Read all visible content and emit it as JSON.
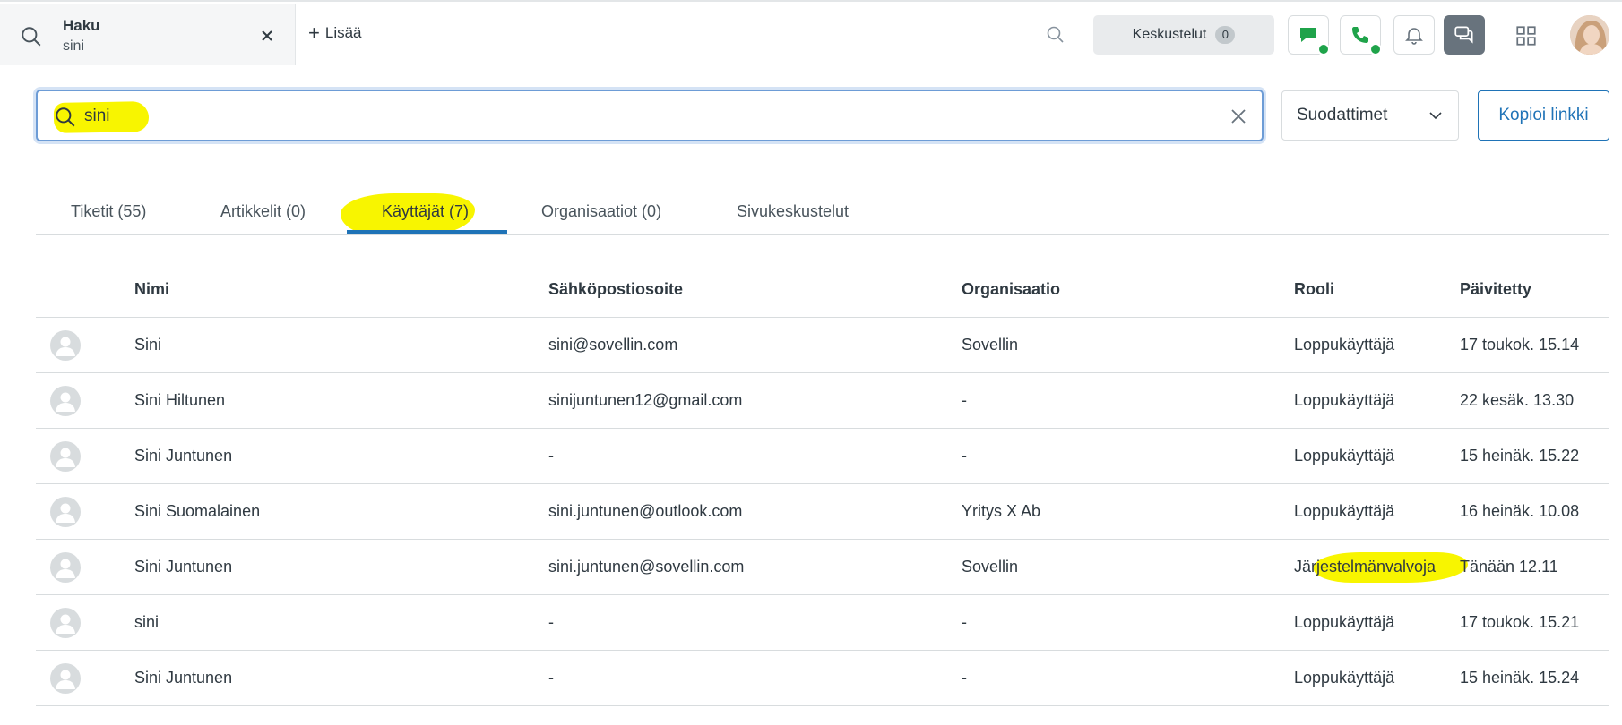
{
  "topbar": {
    "tab": {
      "title": "Haku",
      "subtitle": "sini"
    },
    "add_label": "Lisää",
    "conversations": {
      "label": "Keskustelut",
      "count": "0"
    },
    "status_color": "#1fa34a"
  },
  "search": {
    "value": "sini",
    "filters_label": "Suodattimet",
    "copy_link_label": "Kopioi linkki"
  },
  "result_tabs": [
    {
      "label": "Tiketit (55)"
    },
    {
      "label": "Artikkelit (0)"
    },
    {
      "label": "Käyttäjät (7)",
      "active": true
    },
    {
      "label": "Organisaatiot (0)"
    },
    {
      "label": "Sivukeskustelut"
    }
  ],
  "table": {
    "headers": {
      "name": "Nimi",
      "email": "Sähköpostiosoite",
      "org": "Organisaatio",
      "role": "Rooli",
      "updated": "Päivitetty"
    },
    "rows": [
      {
        "name": "Sini",
        "email": "sini@sovellin.com",
        "org": "Sovellin",
        "role": "Loppukäyttäjä",
        "updated": "17 toukok. 15.14"
      },
      {
        "name": "Sini Hiltunen",
        "email": "sinijuntunen12@gmail.com",
        "org": "-",
        "role": "Loppukäyttäjä",
        "updated": "22 kesäk. 13.30"
      },
      {
        "name": "Sini Juntunen",
        "email": "-",
        "org": "-",
        "role": "Loppukäyttäjä",
        "updated": "15 heinäk. 15.22"
      },
      {
        "name": "Sini Suomalainen",
        "email": "sini.juntunen@outlook.com",
        "org": "Yritys X Ab",
        "role": "Loppukäyttäjä",
        "updated": "16 heinäk. 10.08"
      },
      {
        "name": "Sini Juntunen",
        "email": "sini.juntunen@sovellin.com",
        "org": "Sovellin",
        "role": "Järjestelmänvalvoja",
        "updated": "Tänään 12.11"
      },
      {
        "name": "sini",
        "email": "-",
        "org": "-",
        "role": "Loppukäyttäjä",
        "updated": "17 toukok. 15.21"
      },
      {
        "name": "Sini Juntunen",
        "email": "-",
        "org": "-",
        "role": "Loppukäyttäjä",
        "updated": "15 heinäk. 15.24"
      }
    ]
  },
  "highlight_color": "#f8f500",
  "accent_color": "#1f73b7"
}
